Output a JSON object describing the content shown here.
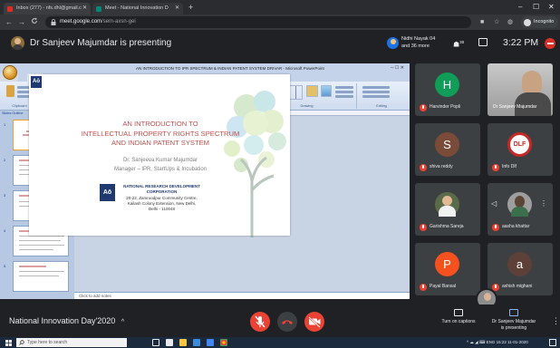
{
  "browser": {
    "tabs": [
      {
        "label": "Inbox (277) - nfs.dhl@gmail.c"
      },
      {
        "label": "Meet - National Innovation D"
      }
    ],
    "new_tab": "+",
    "window_controls": {
      "minimize": "–",
      "maximize": "☐",
      "close": "✕"
    },
    "nav": {
      "back": "←",
      "forward": "→",
      "reload": "C"
    },
    "url_host": "meet.google.com",
    "url_path": "/sem-axsn-gei",
    "incognito_label": "Incognito"
  },
  "meet_header": {
    "presenting_text": "Dr Sanjeev Majumdar is presenting",
    "others_line1": "Nidhi Nayak 04",
    "others_line2": "and 36 more",
    "people_count": "39",
    "time": "3:22 PM"
  },
  "powerpoint": {
    "title": "AN INTRODUCTION TO IPR SPECTRUM & INDIAN PATENT SYSTEM DRIVAR - Microsoft PowerPoint",
    "tabs": [
      "Home",
      "Insert",
      "Design",
      "Animations",
      "Slide Show",
      "Review",
      "View"
    ],
    "ribbon_groups": [
      "Clipboard",
      "Slides",
      "Font",
      "Paragraph",
      "Drawing",
      "Editing"
    ],
    "panel_tabs": "Slides   Outline",
    "slide_numbers": [
      "1",
      "2",
      "3",
      "4",
      "5"
    ],
    "notes_placeholder": "Click to add notes"
  },
  "slide": {
    "logo_mark": "Aō",
    "title_line1": "AN INTRODUCTION TO",
    "title_line2": "INTELLECTUAL PROPERTY RIGHTS SPECTRUM",
    "title_line3": "AND INDIAN PATENT SYSTEM",
    "author_line1": "Dr. Sanjeeva Kumar Majumdar",
    "author_line2": "Manager – IPR, StartUps & Incubation",
    "org_name": "NATIONAL RESEARCH DEVELOPMENT CORPORATION",
    "org_addr1": "20-22, Zamroodpur Community Centre,",
    "org_addr2": "Kailash Colony Extension, New Delhi,",
    "org_addr3": "Delhi - 110048"
  },
  "participants": [
    {
      "name": "Harvinder Popli",
      "initial": "H",
      "color": "#0f9d58"
    },
    {
      "name": "Dr Sanjeev Majumdar",
      "initial": "",
      "color": "#6b6b6b"
    },
    {
      "name": "shiva reddy",
      "initial": "S",
      "color": "#7b4b3a"
    },
    {
      "name": "Info Dlf",
      "initial": "",
      "color": "#c62828"
    },
    {
      "name": "Garishma Sareja",
      "initial": "",
      "color": "#5a6b4a"
    },
    {
      "name": "aasha khattar",
      "initial": "",
      "color": "#9e9e9e"
    },
    {
      "name": "Payal Bansal",
      "initial": "P",
      "color": "#f4511e"
    },
    {
      "name": "ashish mighani",
      "initial": "a",
      "color": "#5d4037"
    }
  ],
  "bottom_bar": {
    "meeting_name": "National Innovation Day'2020",
    "captions_label": "Turn on captions",
    "presenting_label_1": "Dr Sanjeev Majumdar",
    "presenting_label_2": "is presenting"
  },
  "taskbar": {
    "search_placeholder": "Type here to search",
    "tray_text": "^  ☁  ◢  ⌨  ENG   15:22  11-01-2020"
  }
}
